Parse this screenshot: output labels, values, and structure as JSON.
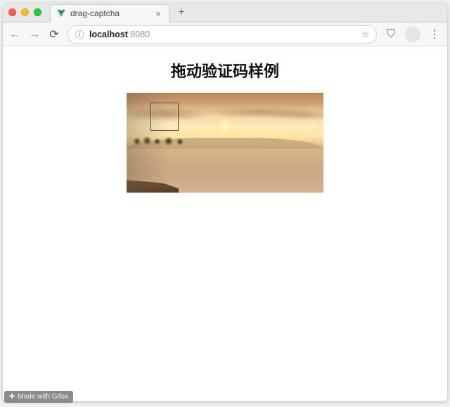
{
  "browser": {
    "tab": {
      "title": "drag-captcha",
      "close_glyph": "×",
      "newtab_glyph": "+"
    },
    "nav": {
      "back_glyph": "←",
      "forward_glyph": "→",
      "reload_glyph": "⟳"
    },
    "address": {
      "info_glyph": "ⓘ",
      "host": "localhost",
      "port": ":8080",
      "star_glyph": "☆",
      "shield_glyph": "⛉",
      "menu_glyph": "⋮"
    }
  },
  "page": {
    "heading": "拖动验证码样例"
  },
  "watermark": {
    "icon": "✚",
    "text": "Made with Gifox"
  }
}
